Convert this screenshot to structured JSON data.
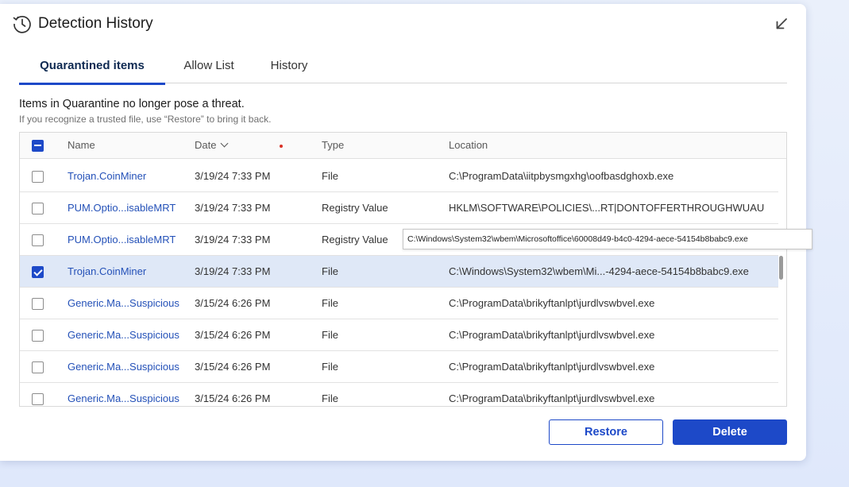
{
  "window": {
    "title": "Detection History"
  },
  "tabs": [
    {
      "label": "Quarantined items",
      "active": true
    },
    {
      "label": "Allow List",
      "active": false
    },
    {
      "label": "History",
      "active": false
    }
  ],
  "info": {
    "main": "Items in Quarantine no longer pose a threat.",
    "sub": "If you recognize a trusted file, use “Restore” to bring it back."
  },
  "table": {
    "columns": {
      "name": "Name",
      "date": "Date",
      "type": "Type",
      "location": "Location"
    },
    "rows": [
      {
        "name": "Trojan.CoinMiner",
        "date": "3/19/24 7:33 PM",
        "type": "File",
        "location": "C:\\ProgramData\\iitpbysmgxhg\\oofbasdghoxb.exe",
        "checked": false
      },
      {
        "name": "PUM.Optio...isableMRT",
        "date": "3/19/24 7:33 PM",
        "type": "Registry Value",
        "location": "HKLM\\SOFTWARE\\POLICIES\\...RT|DONTOFFERTHROUGHWUAU",
        "checked": false
      },
      {
        "name": "PUM.Optio...isableMRT",
        "date": "3/19/24 7:33 PM",
        "type": "Registry Value",
        "location": "",
        "checked": false
      },
      {
        "name": "Trojan.CoinMiner",
        "date": "3/19/24 7:33 PM",
        "type": "File",
        "location": "C:\\Windows\\System32\\wbem\\Mi...-4294-aece-54154b8babc9.exe",
        "checked": true
      },
      {
        "name": "Generic.Ma...Suspicious",
        "date": "3/15/24 6:26 PM",
        "type": "File",
        "location": "C:\\ProgramData\\brikyftanlpt\\jurdlvswbvel.exe",
        "checked": false
      },
      {
        "name": "Generic.Ma...Suspicious",
        "date": "3/15/24 6:26 PM",
        "type": "File",
        "location": "C:\\ProgramData\\brikyftanlpt\\jurdlvswbvel.exe",
        "checked": false
      },
      {
        "name": "Generic.Ma...Suspicious",
        "date": "3/15/24 6:26 PM",
        "type": "File",
        "location": "C:\\ProgramData\\brikyftanlpt\\jurdlvswbvel.exe",
        "checked": false
      },
      {
        "name": "Generic.Ma...Suspicious",
        "date": "3/15/24 6:26 PM",
        "type": "File",
        "location": "C:\\ProgramData\\brikyftanlpt\\jurdlvswbvel.exe",
        "checked": false
      }
    ]
  },
  "tooltip": {
    "text": "C:\\Windows\\System32\\wbem\\Microsoftoffice\\60008d49-b4c0-4294-aece-54154b8babc9.exe"
  },
  "buttons": {
    "restore": "Restore",
    "delete": "Delete"
  },
  "colors": {
    "accent": "#1d49c8",
    "link": "#2451b8",
    "selected_row": "#dfe8f7"
  },
  "icons": {
    "title": "history-clock-icon",
    "minimize": "arrow-down-left-icon",
    "sort": "chevron-down-icon"
  }
}
